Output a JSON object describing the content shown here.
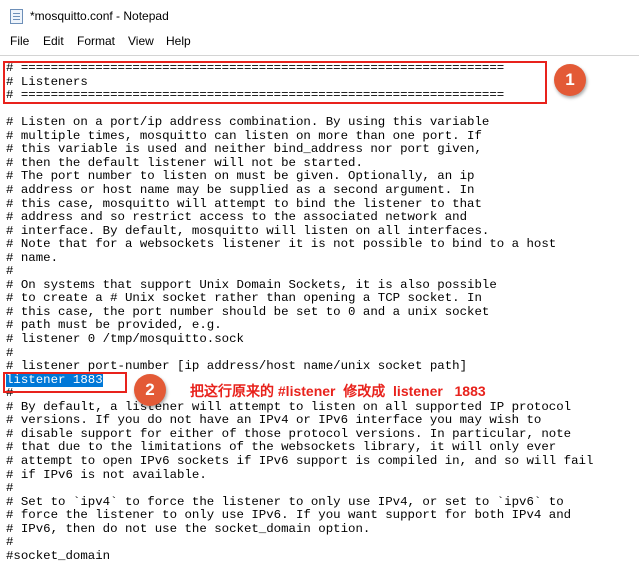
{
  "window": {
    "title": "*mosquitto.conf - Notepad",
    "icon": "notepad-icon"
  },
  "menu": {
    "items": [
      "File",
      "Edit",
      "Format",
      "View",
      "Help"
    ]
  },
  "editor": {
    "lines": [
      "# =================================================================",
      "# Listeners",
      "# =================================================================",
      "",
      "# Listen on a port/ip address combination. By using this variable",
      "# multiple times, mosquitto can listen on more than one port. If",
      "# this variable is used and neither bind_address nor port given,",
      "# then the default listener will not be started.",
      "# The port number to listen on must be given. Optionally, an ip",
      "# address or host name may be supplied as a second argument. In",
      "# this case, mosquitto will attempt to bind the listener to that",
      "# address and so restrict access to the associated network and",
      "# interface. By default, mosquitto will listen on all interfaces.",
      "# Note that for a websockets listener it is not possible to bind to a host",
      "# name.",
      "#",
      "# On systems that support Unix Domain Sockets, it is also possible",
      "# to create a # Unix socket rather than opening a TCP socket. In",
      "# this case, the port number should be set to 0 and a unix socket",
      "# path must be provided, e.g.",
      "# listener 0 /tmp/mosquitto.sock",
      "#",
      "# listener port-number [ip address/host name/unix socket path]",
      "listener 1883",
      "#",
      "# By default, a listener will attempt to listen on all supported IP protocol",
      "# versions. If you do not have an IPv4 or IPv6 interface you may wish to",
      "# disable support for either of those protocol versions. In particular, note",
      "# that due to the limitations of the websockets library, it will only ever",
      "# attempt to open IPv6 sockets if IPv6 support is compiled in, and so will fail",
      "# if IPv6 is not available.",
      "#",
      "# Set to `ipv4` to force the listener to only use IPv4, or set to `ipv6` to",
      "# force the listener to only use IPv6. If you want support for both IPv4 and",
      "# IPv6, then do not use the socket_domain option.",
      "#",
      "#socket_domain"
    ],
    "selected_line_index": 23
  },
  "annotations": {
    "badge1": "1",
    "badge2": "2",
    "instruction": "把这行原来的 #listener  修改成  listener   1883",
    "box_color": "#e8221c",
    "badge_color": "#e35a36"
  },
  "colors": {
    "selection": "#0078d7",
    "text": "#000000"
  }
}
